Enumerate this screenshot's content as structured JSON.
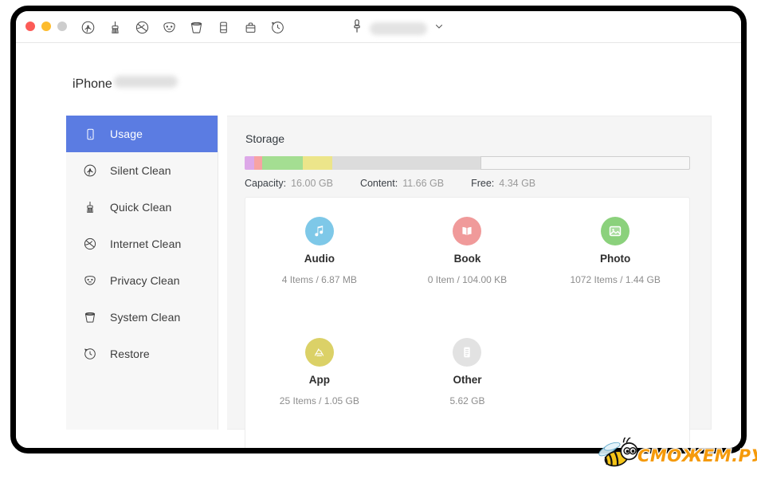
{
  "window": {
    "traffic_lights": [
      "close",
      "minimize",
      "maximize"
    ],
    "toolbar_icons": [
      "silent-clean-icon",
      "quick-clean-icon",
      "internet-clean-icon",
      "privacy-clean-icon",
      "system-clean-icon",
      "phone-icon",
      "briefcase-icon",
      "restore-clock-icon"
    ],
    "device_selector": {
      "icon": "lightning-connector-icon",
      "name": "",
      "chevron": "chevron-down-icon"
    }
  },
  "device": {
    "label": "iPhone",
    "name_redacted": ""
  },
  "sidebar": {
    "items": [
      {
        "label": "Usage",
        "icon": "phone-outline-icon",
        "active": true
      },
      {
        "label": "Silent Clean",
        "icon": "broadcast-icon",
        "active": false
      },
      {
        "label": "Quick Clean",
        "icon": "brush-icon",
        "active": false
      },
      {
        "label": "Internet Clean",
        "icon": "globe-slash-icon",
        "active": false
      },
      {
        "label": "Privacy Clean",
        "icon": "mask-icon",
        "active": false
      },
      {
        "label": "System Clean",
        "icon": "bucket-icon",
        "active": false
      },
      {
        "label": "Restore",
        "icon": "clock-rewind-icon",
        "active": false
      }
    ]
  },
  "main": {
    "storage_title": "Storage",
    "legend": [
      {
        "key": "Capacity:",
        "value": "16.00 GB"
      },
      {
        "key": "Content:",
        "value": "11.66 GB"
      },
      {
        "key": "Free:",
        "value": "4.34 GB"
      }
    ],
    "bar_segments": [
      {
        "name": "audio",
        "color": "#dda8e8",
        "percent": 2.2
      },
      {
        "name": "book",
        "color": "#f7a3a3",
        "percent": 1.8
      },
      {
        "name": "photo",
        "color": "#a4de92",
        "percent": 9.0
      },
      {
        "name": "app",
        "color": "#ece58a",
        "percent": 6.6
      },
      {
        "name": "other",
        "color": "#dcdcdc",
        "percent": 33.3
      },
      {
        "name": "free",
        "color": "#f7f7f7",
        "percent": 47.1
      }
    ],
    "categories": [
      {
        "name": "Audio",
        "meta": "4 Items / 6.87 MB",
        "icon": "music-note-icon",
        "color": "#7ec8e8"
      },
      {
        "name": "Book",
        "meta": "0 Item / 104.00 KB",
        "icon": "open-book-icon",
        "color": "#f09a9a"
      },
      {
        "name": "Photo",
        "meta": "1072 Items / 1.44 GB",
        "icon": "picture-icon",
        "color": "#8bd17c"
      },
      {
        "name": "App",
        "meta": "25 Items / 1.05 GB",
        "icon": "app-store-icon",
        "color": "#dbd167"
      },
      {
        "name": "Other",
        "meta": "5.62 GB",
        "icon": "document-icon",
        "color": "#e2e2e2"
      }
    ]
  },
  "watermark": {
    "text": "СМОЖЕМ.РУ",
    "logo": "bee-icon",
    "color": "#f59a0b"
  }
}
